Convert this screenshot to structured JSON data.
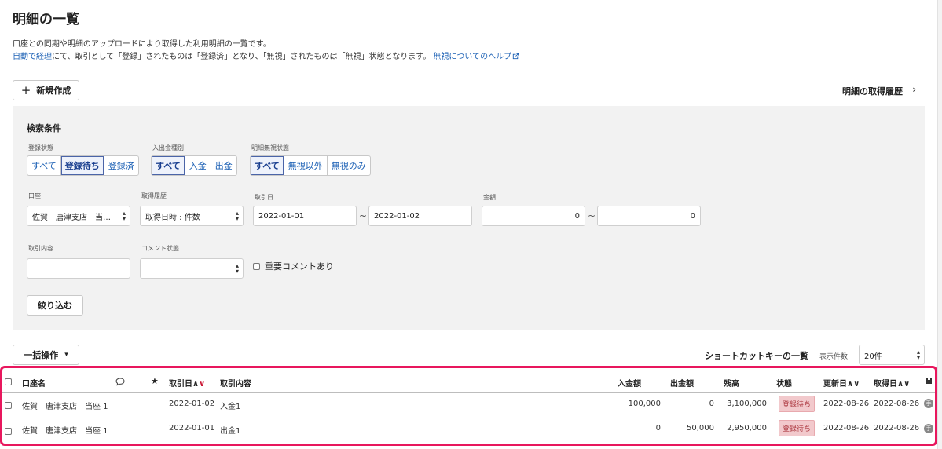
{
  "page": {
    "title": "明細の一覧",
    "desc1": "口座との同期や明細のアップロードにより取得した利用明細の一覧です。",
    "desc2_link": "自動で経理",
    "desc2_text": "にて、取引として「登録」されたものは「登録済」となり、「無視」されたものは「無視」状態となります。",
    "desc2_help": "無視についてのヘルプ"
  },
  "toolbar": {
    "new_button": "新規作成",
    "new_icon": "+",
    "history_link": "明細の取得履歴",
    "history_chevron": "›"
  },
  "search": {
    "title": "検索条件",
    "reg_status_label": "登録状態",
    "reg_status_options": [
      "すべて",
      "登録待ち",
      "登録済"
    ],
    "reg_status_selected": "登録待ち",
    "inout_label": "入出金種別",
    "inout_options": [
      "すべて",
      "入金",
      "出金"
    ],
    "inout_selected": "すべて",
    "ignore_label": "明細無視状態",
    "ignore_options": [
      "すべて",
      "無視以外",
      "無視のみ"
    ],
    "ignore_selected": "すべて",
    "account_label": "口座",
    "account_value": "佐賀　唐津支店　当…",
    "history_label": "取得履歴",
    "history_value": "取得日時 : 件数",
    "date_label": "取引日",
    "date_from": "2022-01-01",
    "date_to": "2022-01-02",
    "tilde": "~",
    "amount_label": "金額",
    "amount_from": "0",
    "amount_to": "0",
    "content_label": "取引内容",
    "content_value": "",
    "comment_label": "コメント状態",
    "comment_value": "",
    "important_comment": "重要コメントあり",
    "filter_button": "絞り込む"
  },
  "list": {
    "bulk_button": "一括操作",
    "bulk_caret": "▾",
    "shortcut_link": "ショートカットキーの一覧",
    "per_page_label": "表示件数",
    "per_page_value": "20件"
  },
  "table": {
    "headers": {
      "account": "口座名",
      "date": "取引日",
      "date_sort": "∧∨",
      "content": "取引内容",
      "deposit": "入金額",
      "withdrawal": "出金額",
      "balance": "残高",
      "status": "状態",
      "updated": "更新日",
      "updated_sort": "∧∨",
      "acquired": "取得日",
      "acquired_sort": "∧∨"
    },
    "rows": [
      {
        "account": "佐賀　唐津支店　当座 1",
        "date": "2022-01-02",
        "content": "入金1",
        "deposit": "100,000",
        "withdrawal": "0",
        "balance": "3,100,000",
        "status": "登録待ち",
        "updated": "2022-08-26",
        "acquired": "2022-08-26",
        "badge_icon": "手"
      },
      {
        "account": "佐賀　唐津支店　当座 1",
        "date": "2022-01-01",
        "content": "出金1",
        "deposit": "0",
        "withdrawal": "50,000",
        "balance": "2,950,000",
        "status": "登録待ち",
        "updated": "2022-08-26",
        "acquired": "2022-08-26",
        "badge_icon": "手"
      }
    ]
  },
  "colors": {
    "highlight_border": "#e8175d",
    "link": "#1a5fb4",
    "status_badge_bg": "#f2c9cc"
  }
}
